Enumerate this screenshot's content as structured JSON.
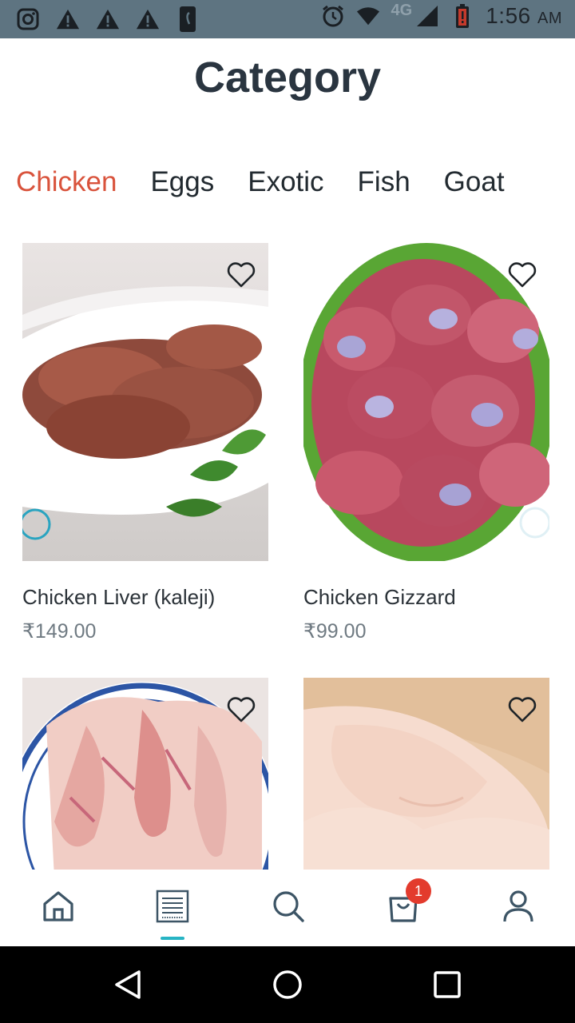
{
  "status_bar": {
    "network": "4G",
    "time": "1:56",
    "ampm": "AM"
  },
  "header": {
    "title": "Category"
  },
  "tabs": [
    {
      "label": "Chicken",
      "active": true
    },
    {
      "label": "Eggs",
      "active": false
    },
    {
      "label": "Exotic",
      "active": false
    },
    {
      "label": "Fish",
      "active": false
    },
    {
      "label": "Goat",
      "active": false
    }
  ],
  "products": [
    {
      "name": "Chicken Liver (kaleji)",
      "price": "₹149.00"
    },
    {
      "name": "Chicken Gizzard",
      "price": "₹99.00"
    },
    {
      "name": "",
      "price": ""
    },
    {
      "name": "",
      "price": ""
    }
  ],
  "bottom_nav": {
    "items": [
      "home-icon",
      "category-icon",
      "search-icon",
      "cart-icon",
      "profile-icon"
    ],
    "active": "category-icon",
    "cart_count": "1",
    "accent": "#27b4c4"
  },
  "colors": {
    "active_tab": "#d9533c",
    "status_bar": "#5e7481",
    "badge": "#e33b2d"
  }
}
